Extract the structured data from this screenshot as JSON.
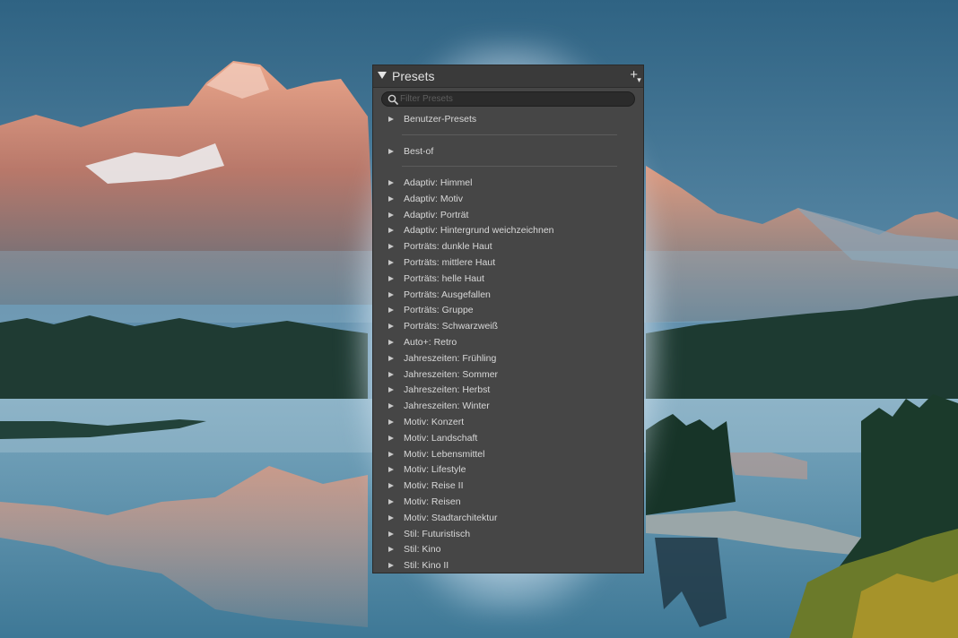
{
  "presets_panel": {
    "title": "Presets",
    "search_placeholder": "Filter Presets",
    "top_groups": [
      "Benutzer-Presets",
      "Best-of"
    ],
    "groups": [
      "Adaptiv: Himmel",
      "Adaptiv: Motiv",
      "Adaptiv: Porträt",
      "Adaptiv: Hintergrund weichzeichnen",
      "Porträts: dunkle Haut",
      "Porträts: mittlere Haut",
      "Porträts: helle Haut",
      "Porträts: Ausgefallen",
      "Porträts: Gruppe",
      "Porträts: Schwarzweiß",
      "Auto+: Retro",
      "Jahreszeiten: Frühling",
      "Jahreszeiten: Sommer",
      "Jahreszeiten: Herbst",
      "Jahreszeiten: Winter",
      "Motiv: Konzert",
      "Motiv: Landschaft",
      "Motiv: Lebensmittel",
      "Motiv: Lifestyle",
      "Motiv: Reise II",
      "Motiv: Reisen",
      "Motiv: Stadtarchitektur",
      "Stil: Futuristisch",
      "Stil: Kino",
      "Stil: Kino II"
    ],
    "colors": {
      "panel_bg": "#464646",
      "header_bg": "#3a3a3a",
      "text": "#d8d8d8"
    },
    "icons": {
      "collapse": "triangle-down-icon",
      "add": "plus-icon",
      "search": "search-icon",
      "group": "triangle-right-icon"
    }
  }
}
